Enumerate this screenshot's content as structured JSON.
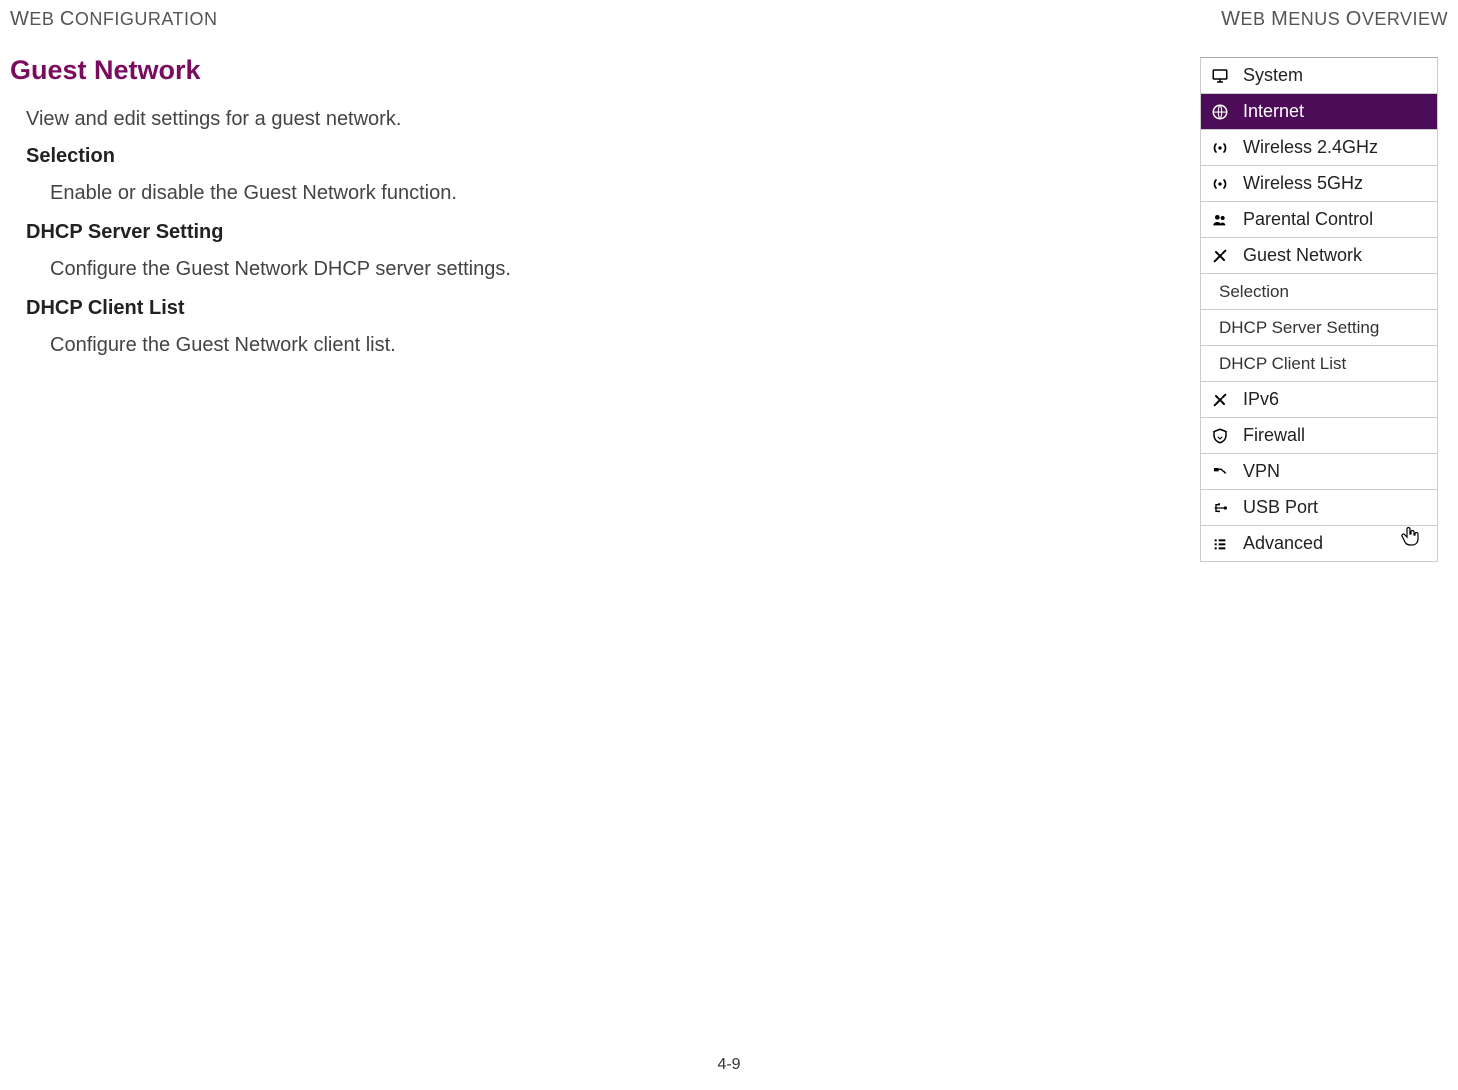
{
  "header": {
    "left_first": "W",
    "left_rest": "EB ",
    "left_word2_first": "C",
    "left_word2_rest": "ONFIGURATION",
    "right_first": "W",
    "right_rest": "EB ",
    "right_word2_first": "M",
    "right_word2_rest": "ENUS ",
    "right_word3_first": "O",
    "right_word3_rest": "VERVIEW"
  },
  "title": "Guest Network",
  "intro": "View and edit settings for a guest network.",
  "sections": {
    "s1": {
      "head": "Selection",
      "desc": "Enable or disable the Guest Network function."
    },
    "s2": {
      "head": "DHCP Server Setting",
      "desc": "Configure the Guest Network DHCP server settings."
    },
    "s3": {
      "head": "DHCP Client List",
      "desc": "Configure the Guest Network client list."
    }
  },
  "menu": {
    "system": "System",
    "internet": "Internet",
    "wireless24": "Wireless 2.4GHz",
    "wireless5": "Wireless 5GHz",
    "parental": "Parental Control",
    "guest": "Guest Network",
    "selection": "Selection",
    "dhcp_server": "DHCP Server Setting",
    "dhcp_client": "DHCP Client List",
    "ipv6": "IPv6",
    "firewall": "Firewall",
    "vpn": "VPN",
    "usb": "USB Port",
    "advanced": "Advanced"
  },
  "page_number": "4-9"
}
